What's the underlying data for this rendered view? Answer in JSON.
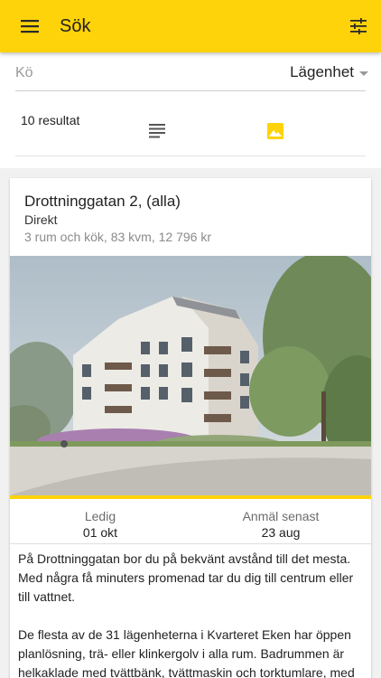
{
  "appbar": {
    "title": "Sök",
    "menu_icon": "hamburger-menu-icon",
    "filter_icon": "tune-filter-icon"
  },
  "filter": {
    "queue_label": "Kö",
    "housing_type": "Lägenhet",
    "results": "10 resultat",
    "view_modes": [
      "list-view-icon",
      "image-view-icon"
    ],
    "active_view": "image",
    "accent": "#ffd30a"
  },
  "listing": {
    "address": "Drottninggatan 2, (alla)",
    "kind": "Direkt",
    "summary": "3 rum och kök, 83 kvm, 12 796 kr",
    "available_label": "Ledig",
    "available_value": "01 okt",
    "deadline_label": "Anmäl senast",
    "deadline_value": "23 aug",
    "description": [
      "På Drottninggatan bor du på bekvänt avstånd till det mesta. Med några få minuters promenad tar du dig till centrum eller till vattnet.",
      "De flesta av de 31 lägenheterna i Kvarteret Eken har öppen planlösning, trä- eller klinkergolv i alla rum. Badrummen är helkaklade med tvättbänk, tvättmaskin och torktumlare, med"
    ]
  }
}
